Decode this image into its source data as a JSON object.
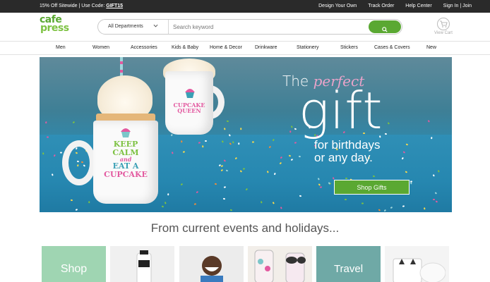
{
  "promo": {
    "text": "15% Off Sitewide | Use Code: ",
    "code": "GIFT15"
  },
  "util_links": [
    {
      "label": "Design Your Own"
    },
    {
      "label": "Track Order"
    },
    {
      "label": "Help Center"
    },
    {
      "label": "Sign In | Join"
    }
  ],
  "logo": {
    "line1": "cafe",
    "line2": "press"
  },
  "search": {
    "department": "All Departments",
    "placeholder": "Search keyword",
    "icon": "search-icon"
  },
  "cart": {
    "label": "View Cart",
    "icon": "cart-icon"
  },
  "nav": [
    {
      "label": "Men"
    },
    {
      "label": "Women"
    },
    {
      "label": "Accessories"
    },
    {
      "label": "Kids & Baby"
    },
    {
      "label": "Home & Decor"
    },
    {
      "label": "Drinkware"
    },
    {
      "label": "Stationery"
    },
    {
      "label": "Stickers"
    },
    {
      "label": "Cases & Covers"
    },
    {
      "label": "New"
    }
  ],
  "hero": {
    "line1_pre": "The ",
    "line1_accent": "perfect",
    "line2": "gift",
    "line3a": "for birthdays",
    "line3b": "or any day.",
    "cta": "Shop Gifts",
    "mug_left": {
      "l1": "KEEP",
      "l2": "CALM",
      "l3": "and",
      "l4": "EAT A",
      "l5": "CUPCAKE"
    },
    "mug_right": {
      "l1": "CUPCAKE",
      "l2": "QUEEN"
    },
    "colors": {
      "pink": "#e35aa0",
      "green": "#5aa832",
      "teal": "#2a8cb5"
    }
  },
  "section_heading": "From current events and holidays...",
  "tiles": [
    {
      "label": "Shop",
      "color": "#9fd5b2"
    },
    {
      "label": "",
      "color": "#f0f0f0"
    },
    {
      "label": "",
      "color": "#ececec"
    },
    {
      "label": "",
      "color": "#f2eee9"
    },
    {
      "label": "Travel",
      "color": "#6fa9a6"
    },
    {
      "label": "",
      "color": "#f4f4f4"
    }
  ]
}
